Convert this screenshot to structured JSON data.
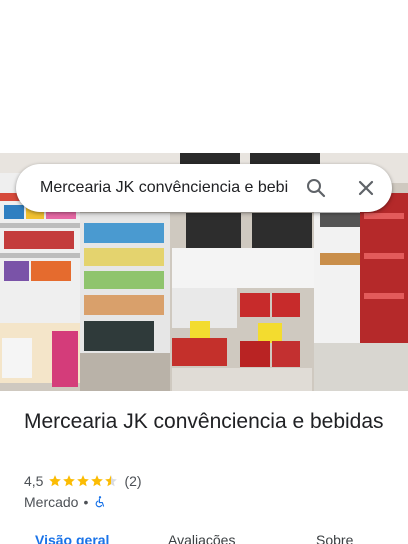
{
  "search": {
    "value": "Mercearia JK convênciencia e bebidas"
  },
  "place": {
    "title": "Mercearia JK convênciencia e bebidas",
    "rating": "4,5",
    "stars_value": 4.5,
    "stars_max": 5,
    "review_count": "(2)",
    "category": "Mercado",
    "separator": "•",
    "accessibility_icon": "wheelchair-icon"
  },
  "tabs": [
    {
      "label": "Visão geral",
      "active": true
    },
    {
      "label": "Avaliações",
      "active": false
    },
    {
      "label": "Sobre",
      "active": false
    }
  ],
  "colors": {
    "star": "#fbbc04",
    "active_tab": "#1a73e8",
    "accessibility": "#1a73e8"
  }
}
